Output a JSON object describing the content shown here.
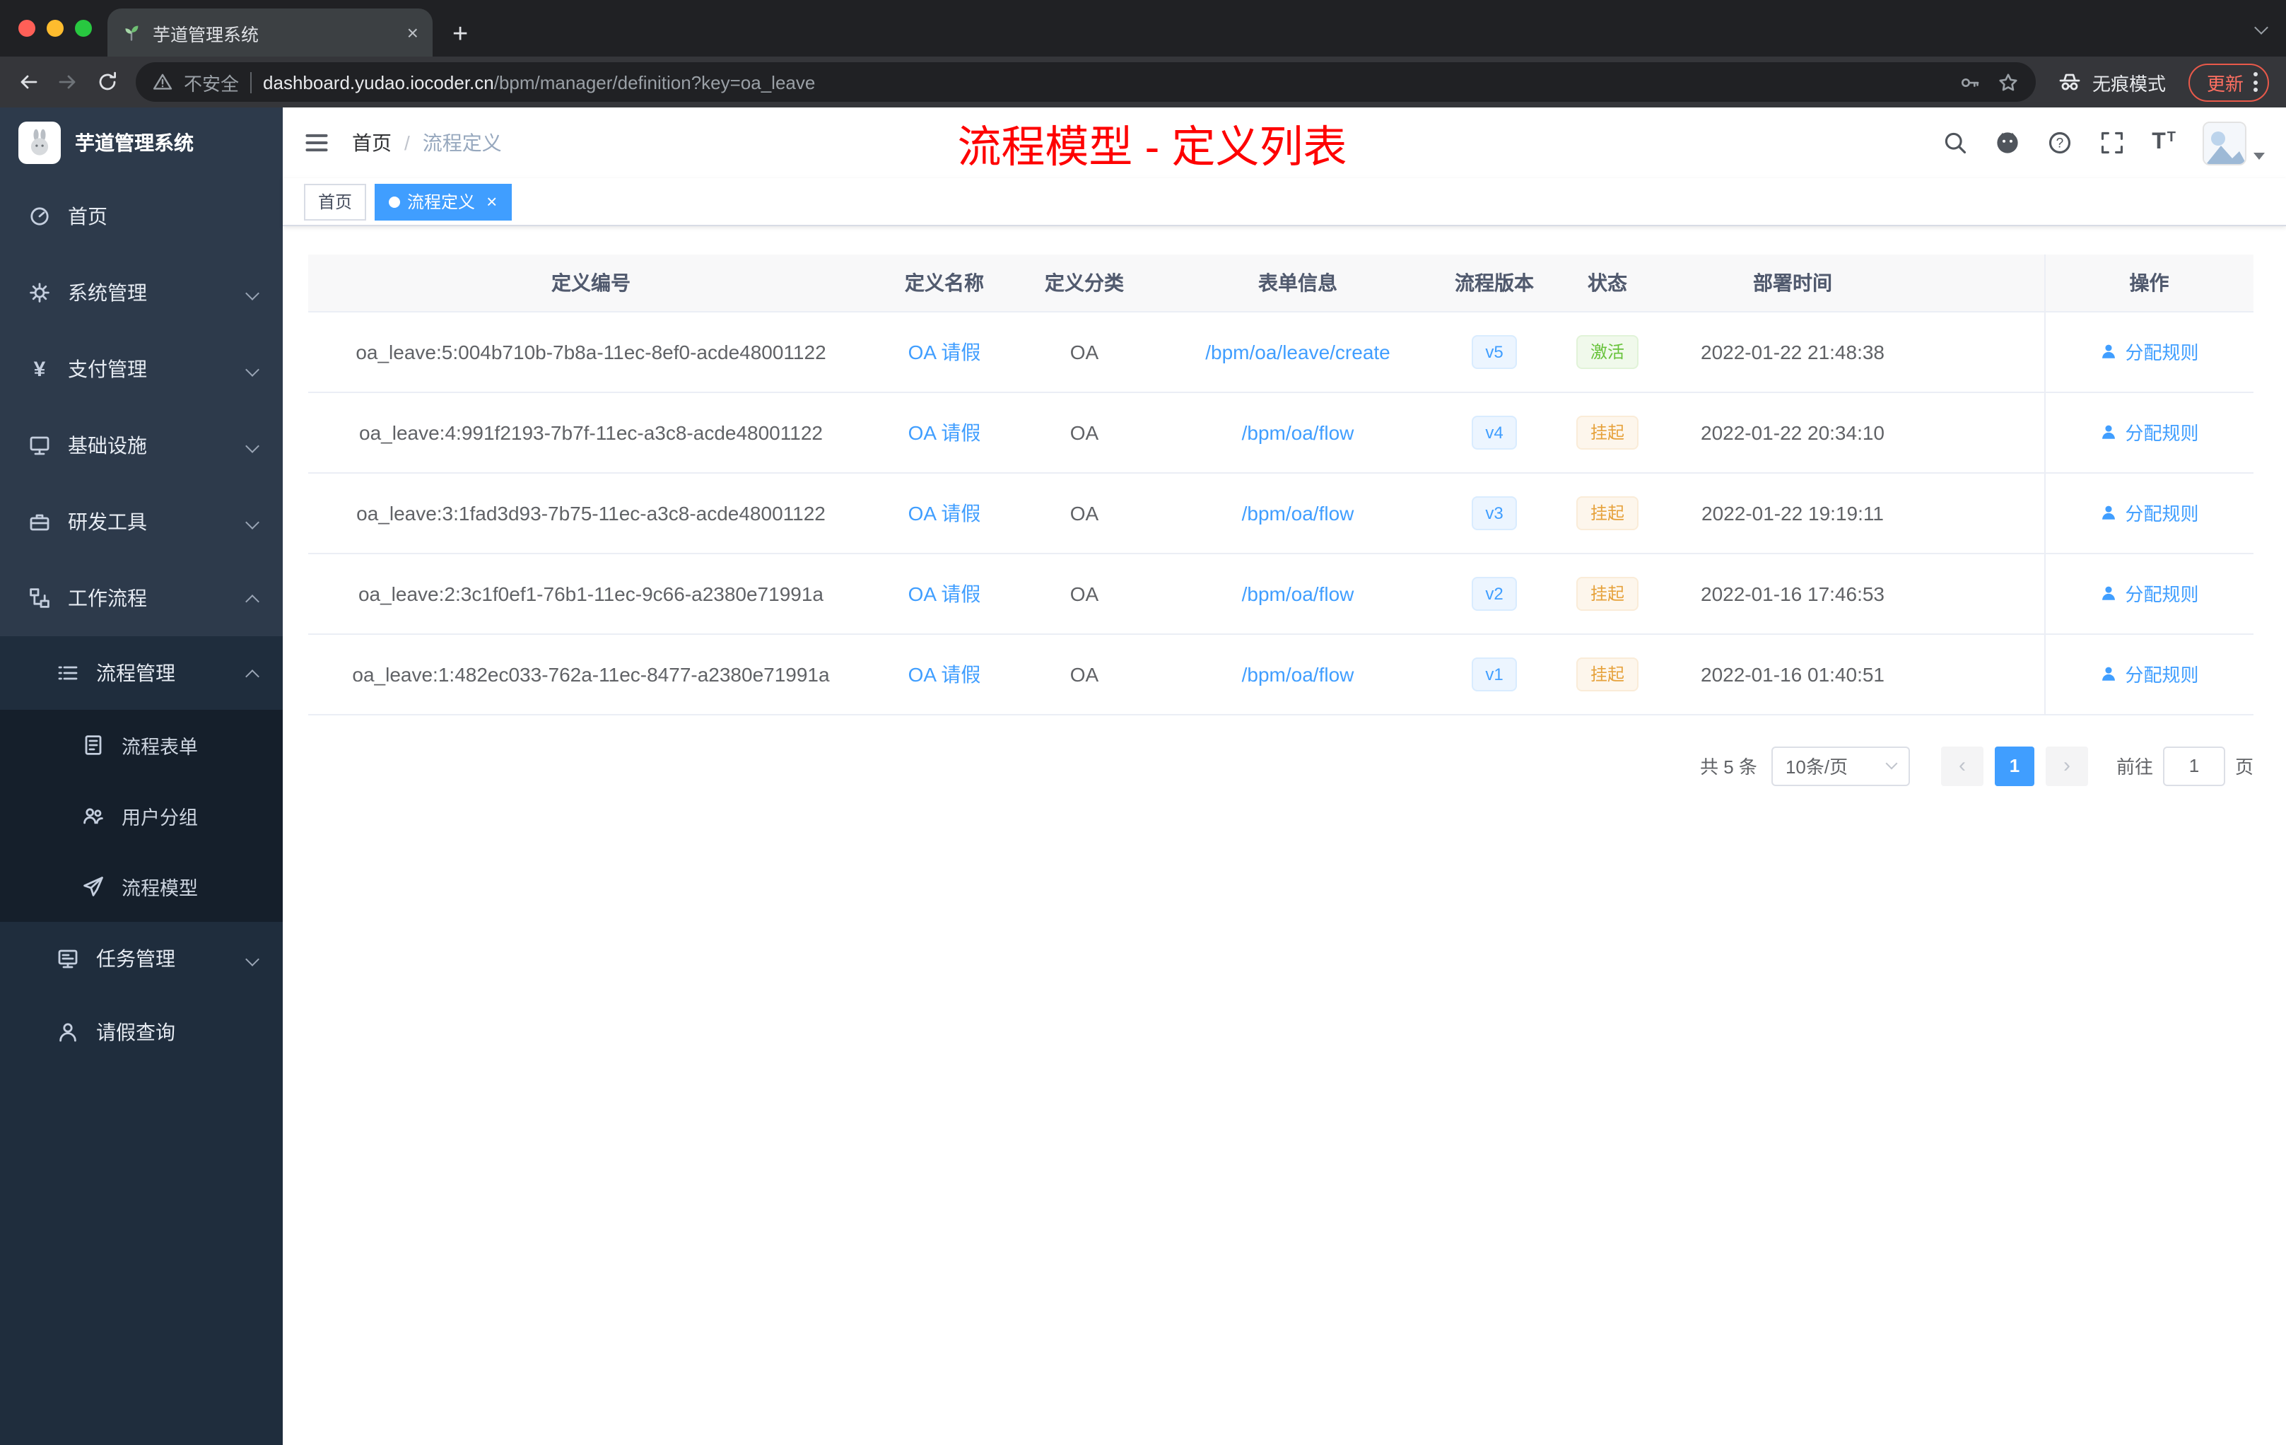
{
  "colors": {
    "accent": "#409eff",
    "title_red": "#fe0000",
    "success": "#67c23a",
    "warning": "#e6a23c"
  },
  "browser": {
    "tab_title": "芋道管理系统",
    "security_label": "不安全",
    "url_domain": "dashboard.yudao.iocoder.cn",
    "url_path": "/bpm/manager/definition?key=oa_leave",
    "incognito_label": "无痕模式",
    "update_label": "更新"
  },
  "sidebar": {
    "app_title": "芋道管理系统",
    "items": [
      {
        "label": "首页"
      },
      {
        "label": "系统管理"
      },
      {
        "label": "支付管理"
      },
      {
        "label": "基础设施"
      },
      {
        "label": "研发工具"
      },
      {
        "label": "工作流程"
      }
    ],
    "submenu": {
      "process": {
        "label": "流程管理",
        "children": [
          {
            "label": "流程表单"
          },
          {
            "label": "用户分组"
          },
          {
            "label": "流程模型"
          }
        ]
      },
      "task": {
        "label": "任务管理"
      },
      "leave": {
        "label": "请假查询"
      }
    }
  },
  "header": {
    "breadcrumb": [
      {
        "label": "首页"
      },
      {
        "label": "流程定义"
      }
    ],
    "separator": "/",
    "page_title": "流程模型 - 定义列表"
  },
  "tags": [
    {
      "label": "首页",
      "active": false
    },
    {
      "label": "流程定义",
      "active": true
    }
  ],
  "table": {
    "columns": [
      "定义编号",
      "定义名称",
      "定义分类",
      "表单信息",
      "流程版本",
      "状态",
      "部署时间",
      "操作"
    ],
    "rows": [
      {
        "id": "oa_leave:5:004b710b-7b8a-11ec-8ef0-acde48001122",
        "name": "OA 请假",
        "category": "OA",
        "form": "/bpm/oa/leave/create",
        "version": "v5",
        "status": "激活",
        "status_type": "success",
        "time": "2022-01-22 21:48:38",
        "action": "分配规则"
      },
      {
        "id": "oa_leave:4:991f2193-7b7f-11ec-a3c8-acde48001122",
        "name": "OA 请假",
        "category": "OA",
        "form": "/bpm/oa/flow",
        "version": "v4",
        "status": "挂起",
        "status_type": "warning",
        "time": "2022-01-22 20:34:10",
        "action": "分配规则"
      },
      {
        "id": "oa_leave:3:1fad3d93-7b75-11ec-a3c8-acde48001122",
        "name": "OA 请假",
        "category": "OA",
        "form": "/bpm/oa/flow",
        "version": "v3",
        "status": "挂起",
        "status_type": "warning",
        "time": "2022-01-22 19:19:11",
        "action": "分配规则"
      },
      {
        "id": "oa_leave:2:3c1f0ef1-76b1-11ec-9c66-a2380e71991a",
        "name": "OA 请假",
        "category": "OA",
        "form": "/bpm/oa/flow",
        "version": "v2",
        "status": "挂起",
        "status_type": "warning",
        "time": "2022-01-16 17:46:53",
        "action": "分配规则"
      },
      {
        "id": "oa_leave:1:482ec033-762a-11ec-8477-a2380e71991a",
        "name": "OA 请假",
        "category": "OA",
        "form": "/bpm/oa/flow",
        "version": "v1",
        "status": "挂起",
        "status_type": "warning",
        "time": "2022-01-16 01:40:51",
        "action": "分配规则"
      }
    ]
  },
  "pagination": {
    "total": "共 5 条",
    "page_size": "10条/页",
    "current_page": "1",
    "prev_label": "‹",
    "next_label": "›",
    "goto_label": "前往",
    "goto_value": "1",
    "unit_label": "页"
  },
  "icons": [
    "leaf-favicon",
    "warning",
    "key",
    "bookmark-star",
    "incognito",
    "hamburger",
    "search",
    "github",
    "help",
    "fullscreen",
    "font-size",
    "home",
    "system-gear",
    "payment-yen",
    "infrastructure",
    "devtools",
    "workflow",
    "process-manage",
    "process-form",
    "user-group",
    "process-model",
    "task-manage",
    "leave-person",
    "assign-user"
  ]
}
